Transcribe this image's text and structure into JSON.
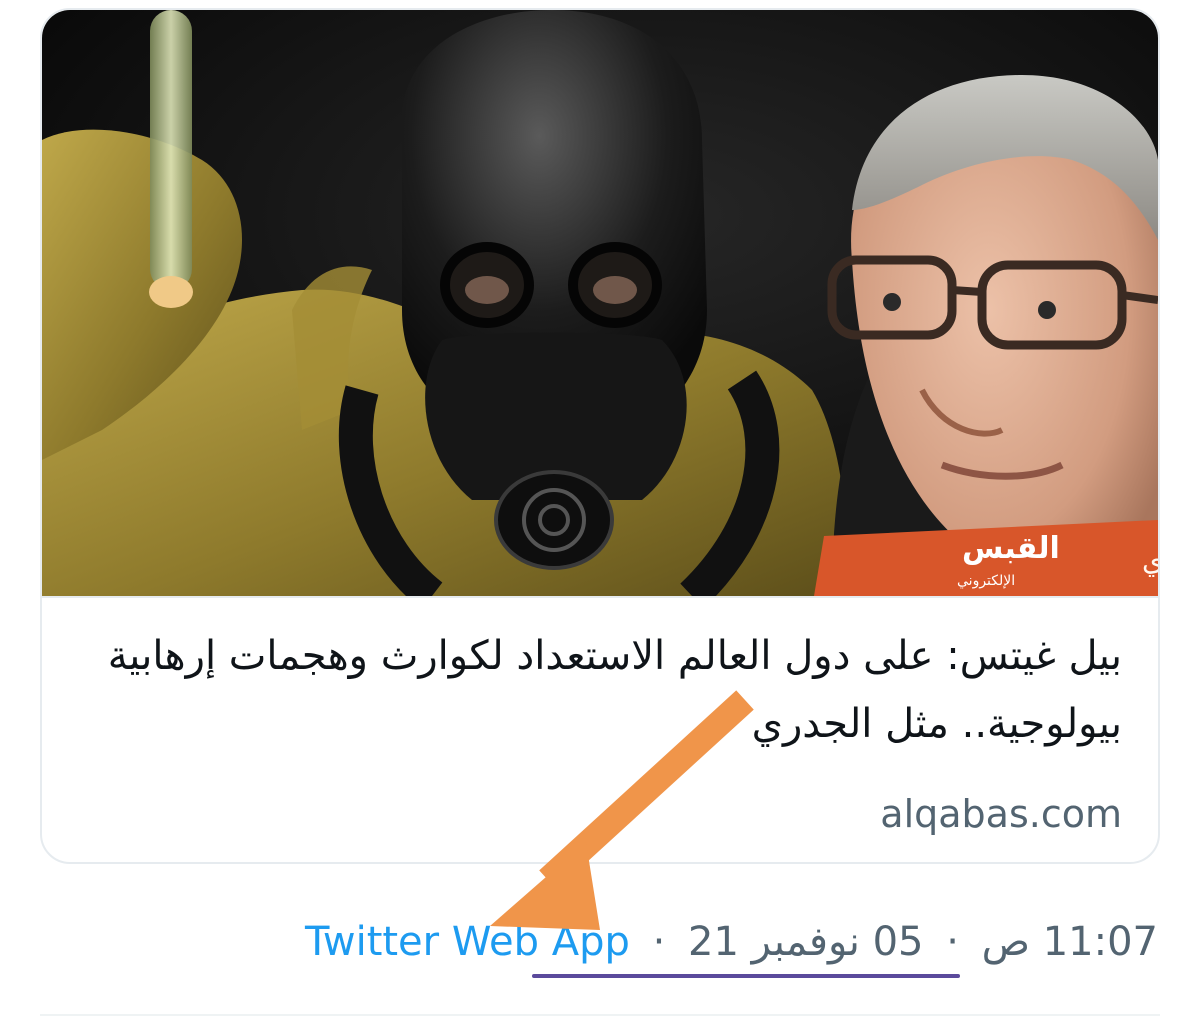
{
  "card": {
    "image": {
      "banner_report": "تقرير حصري",
      "banner_logo_main": "القبس",
      "banner_logo_sub": "الإلكتروني"
    },
    "title": "بيل غيتس: على دول العالم الاستعداد لكوارث وهجمات إرهابية بيولوجية.. مثل الجدري",
    "domain": "alqabas.com"
  },
  "meta": {
    "time": "11:07 ص",
    "separator": "·",
    "date": "05 نوفمبر 21",
    "source": "Twitter Web App"
  },
  "colors": {
    "link": "#1d9bf0",
    "meta_text": "#536471",
    "arrow": "#f0954a",
    "underline": "#5b4a9c",
    "banner": "#d8562a"
  }
}
